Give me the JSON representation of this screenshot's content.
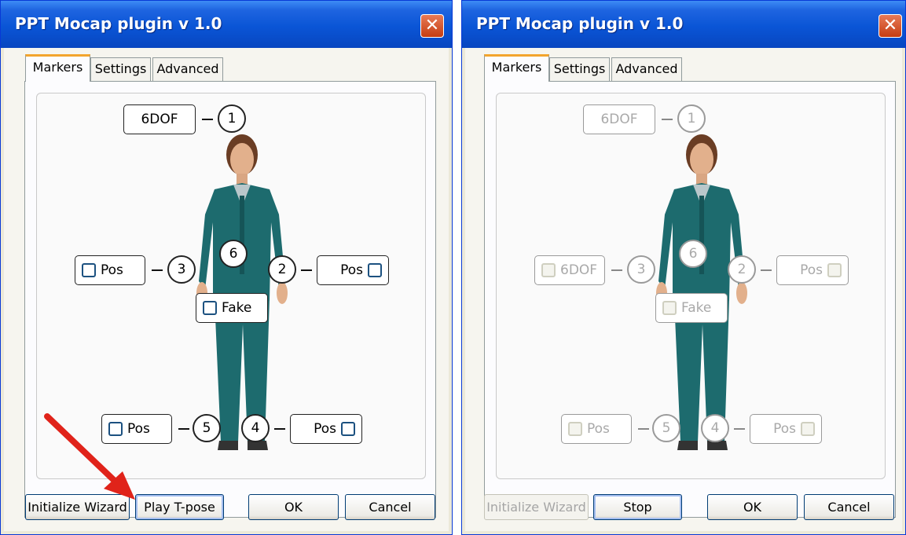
{
  "dialogs": [
    {
      "title": "PPT Mocap plugin v 1.0",
      "close": "✕",
      "tabs": [
        "Markers",
        "Settings",
        "Advanced"
      ],
      "active_tab": "Markers",
      "top_label": "6DOF",
      "left_arm": "Pos",
      "right_arm": "Pos",
      "fake": "Fake",
      "left_leg": "Pos",
      "right_leg": "Pos",
      "markers": [
        "1",
        "2",
        "3",
        "4",
        "5",
        "6"
      ],
      "buttons": {
        "init": "Initialize Wizard",
        "play": "Play T-pose",
        "ok": "OK",
        "cancel": "Cancel"
      }
    },
    {
      "title": "PPT Mocap plugin v 1.0",
      "close": "✕",
      "tabs": [
        "Markers",
        "Settings",
        "Advanced"
      ],
      "active_tab": "Markers",
      "top_label": "6DOF",
      "left_arm": "6DOF",
      "right_arm": "Pos",
      "fake": "Fake",
      "left_leg": "Pos",
      "right_leg": "Pos",
      "markers": [
        "1",
        "2",
        "3",
        "4",
        "5",
        "6"
      ],
      "buttons": {
        "init": "Initialize Wizard",
        "play": "Stop",
        "ok": "OK",
        "cancel": "Cancel"
      }
    }
  ],
  "colors": {
    "titlebar": "#0a55d6",
    "suit": "#1d6b6e",
    "arrow": "#e0231a"
  }
}
